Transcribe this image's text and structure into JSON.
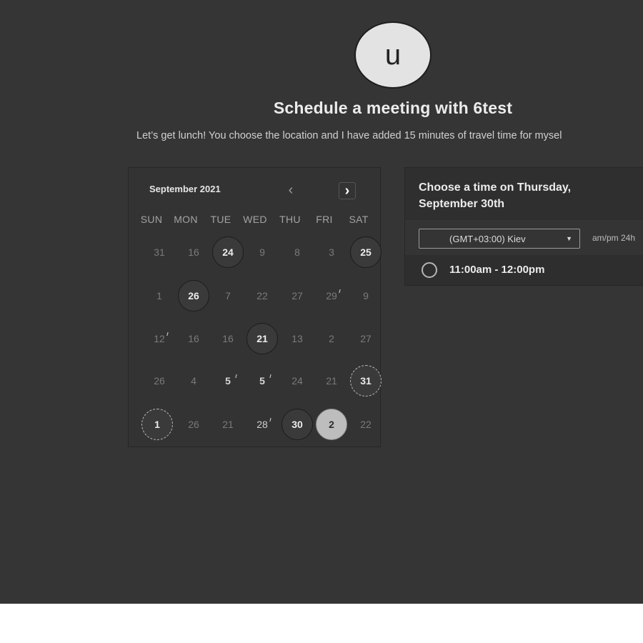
{
  "host": {
    "avatar_letter": "u",
    "title": "Schedule a meeting with 6test",
    "description": "Let’s get lunch! You choose the location and I have added 15 minutes of travel time for mysel"
  },
  "calendar": {
    "month_label": "September 2021",
    "prev_icon": "chevron-left-icon",
    "next_icon": "chevron-right-icon",
    "weekdays": [
      "SUN",
      "MON",
      "TUE",
      "WED",
      "THU",
      "FRI",
      "SAT"
    ],
    "weeks": [
      [
        "31",
        "16",
        "24",
        "9",
        "8",
        "3",
        "25"
      ],
      [
        "1",
        "26",
        "7",
        "22",
        "27",
        "29",
        "9"
      ],
      [
        "12",
        "16",
        "16",
        "21",
        "13",
        "2",
        "27"
      ],
      [
        "26",
        "4",
        "5",
        "5",
        "24",
        "21",
        "31"
      ],
      [
        "1",
        "26",
        "21",
        "28",
        "30",
        "2",
        "22"
      ]
    ]
  },
  "time_panel": {
    "heading_line1": "Choose a time on Thursday,",
    "heading_line2": "September 30th",
    "timezone_value": "(GMT+03:00) Kiev",
    "format_toggle": "am/pm  24h",
    "slots": [
      {
        "label": "11:00am - 12:00pm"
      }
    ]
  },
  "colors": {
    "background": "#353535",
    "selected_day": "#bdbdbd"
  }
}
